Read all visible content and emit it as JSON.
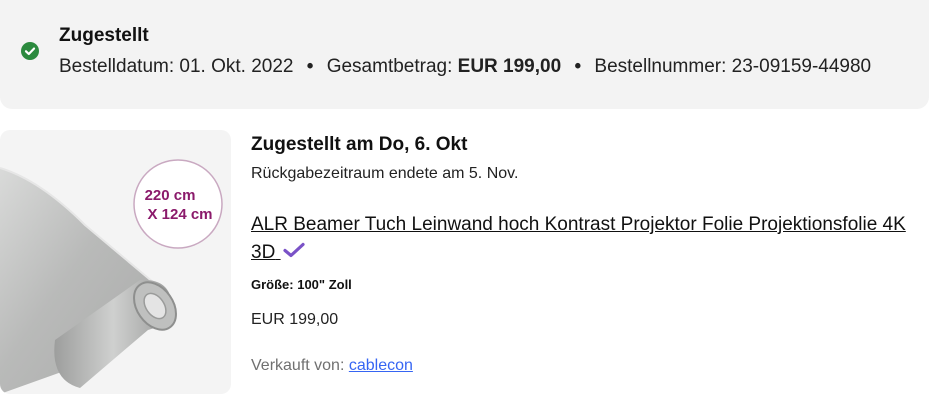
{
  "order": {
    "status": "Zugestellt",
    "order_date_label": "Bestelldatum:",
    "order_date": "01. Okt. 2022",
    "separator": "•",
    "total_label": "Gesamtbetrag:",
    "total": "EUR 199,00",
    "order_number_label": "Bestellnummer:",
    "order_number": "23-09159-44980",
    "status_icon": "check-circle-icon",
    "status_color": "#2b8a3e"
  },
  "item": {
    "delivered_text": "Zugestellt am Do, 6. Okt",
    "return_note": "Rückgabezeitraum endete am 5. Nov.",
    "title": "ALR Beamer Tuch Leinwand hoch Kontrast Projektor Folie Projektionsfolie 4K 3D",
    "verified_icon": "checkmark-icon",
    "verified_color": "#7a52c7",
    "size": "Größe: 100\" Zoll",
    "price": "EUR 199,00",
    "seller_label": "Verkauft von:",
    "seller_name": "cablecon",
    "image": {
      "badge_line1": "220 cm",
      "badge_line2": "X 124 cm",
      "badge_color": "#8b1a6b"
    }
  }
}
